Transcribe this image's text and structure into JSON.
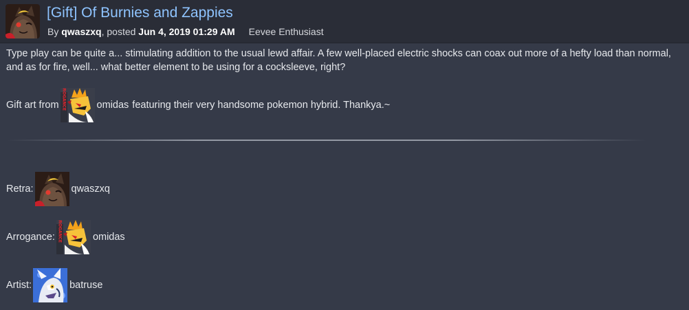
{
  "post": {
    "title": "[Gift] Of Burnies and Zappies",
    "byline_prefix": "By ",
    "author": "qwaszxq",
    "posted_label": ", posted ",
    "date": "Jun 4, 2019 01:29 AM",
    "author_title": "Eevee Enthusiast"
  },
  "body": {
    "paragraph": "Type play can be quite a... stimulating addition to the usual lewd affair. A few well-placed electric shocks can coax out more of a hefty load than normal, and as for fire, well... what better element to be using for a cocksleeve, right?",
    "gift_prefix": "Gift art from",
    "gift_user": "omidas",
    "gift_suffix": "featuring their very handsome pokemon hybrid. Thankya.~"
  },
  "credits": [
    {
      "label": "Retra:",
      "user": "qwaszxq",
      "icon": "avatar-qwaszxq"
    },
    {
      "label": "Arrogance:",
      "user": "omidas",
      "icon": "avatar-omidas"
    },
    {
      "label": "Artist:",
      "user": "batruse",
      "icon": "avatar-batruse"
    }
  ],
  "colors": {
    "background": "#353a48",
    "header": "#2a2d37",
    "title_link": "#8fc4ff",
    "text": "#e6e8ec"
  }
}
